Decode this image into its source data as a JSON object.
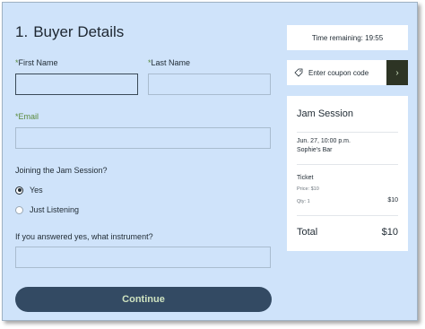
{
  "form": {
    "step_number": "1.",
    "title": "Buyer Details",
    "first_name_label": "First Name",
    "last_name_label": "Last Name",
    "email_label": "Email",
    "required_mark": "*",
    "question": "Joining the Jam Session?",
    "options": [
      {
        "label": "Yes",
        "checked": true
      },
      {
        "label": "Just Listening",
        "checked": false
      }
    ],
    "instrument_label": "If you answered yes, what instrument?",
    "continue_label": "Continue"
  },
  "sidebar": {
    "timer_text": "Time remaining: 19:55",
    "coupon_placeholder": "Enter coupon code",
    "coupon_arrow": "›",
    "event_title": "Jam Session",
    "event_date": "Jun. 27, 10:00 p.m.",
    "event_venue": "Sophie's Bar",
    "ticket_label": "Ticket",
    "price_text": "Price: $10",
    "qty_text": "Qty: 1",
    "line_amount": "$10",
    "total_label": "Total",
    "total_amount": "$10"
  },
  "colors": {
    "background": "#cfe3fa",
    "button": "#334a63",
    "button_text": "#cfe3c0",
    "required_accent": "#5a8a3c"
  }
}
